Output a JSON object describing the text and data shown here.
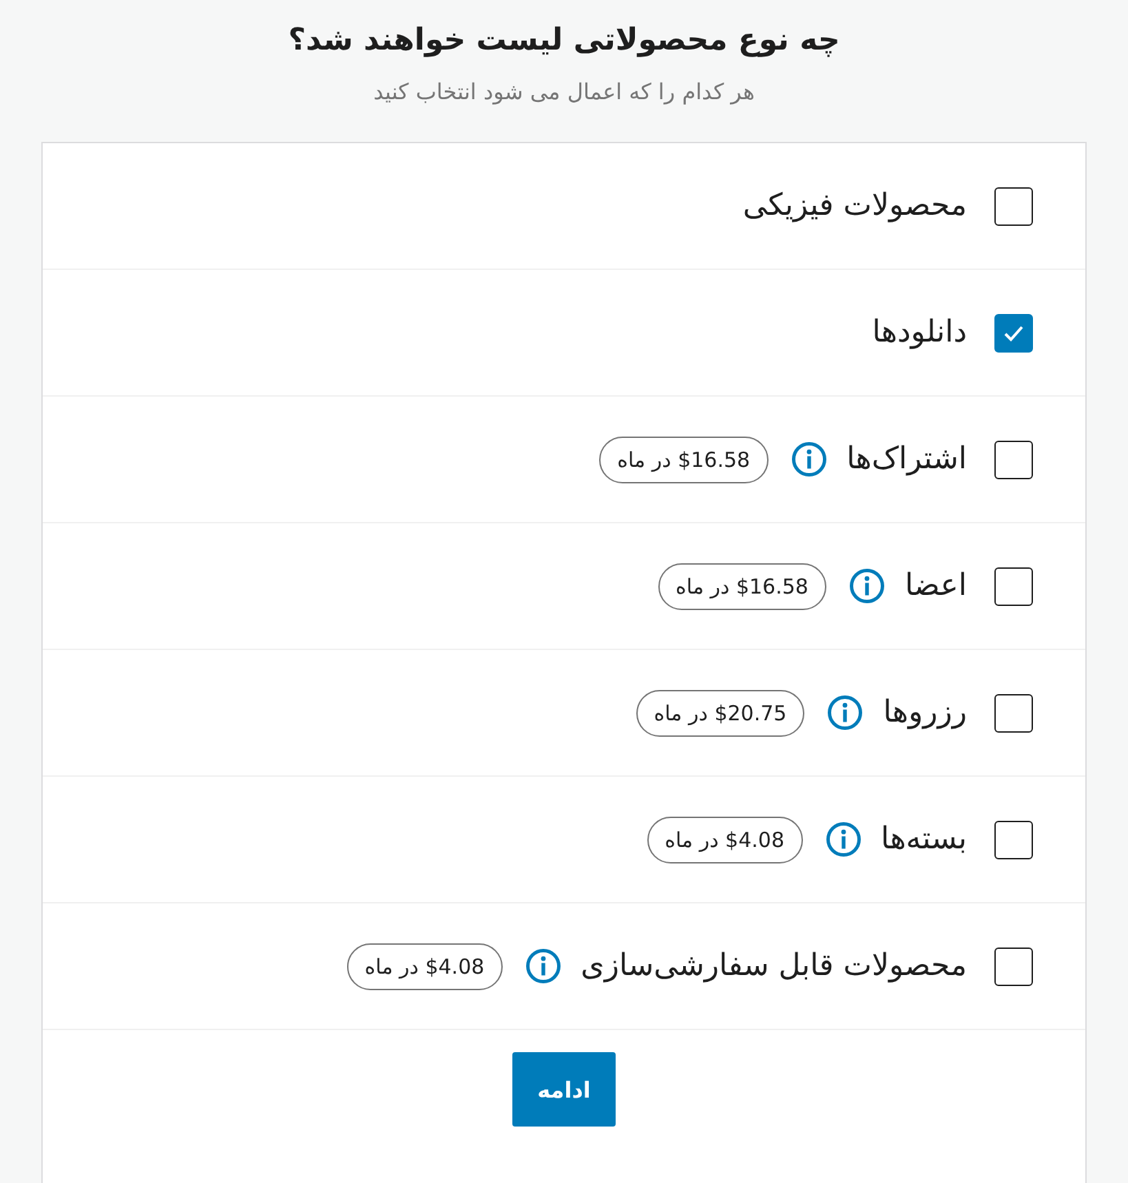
{
  "title": "چه نوع محصولاتی لیست خواهند شد؟",
  "subtitle": "هر کدام را که اعمال می شود انتخاب کنید",
  "options": [
    {
      "label": "محصولات فیزیکی",
      "checked": false
    },
    {
      "label": "دانلودها",
      "checked": true
    },
    {
      "label": "اشتراک‌ها",
      "checked": false,
      "price": "$16.58 در ماه"
    },
    {
      "label": "اعضا",
      "checked": false,
      "price": "$16.58 در ماه"
    },
    {
      "label": "رزروها",
      "checked": false,
      "price": "$20.75 در ماه"
    },
    {
      "label": "بسته‌ها",
      "checked": false,
      "price": "$4.08 در ماه"
    },
    {
      "label": "محصولات قابل سفارشی‌سازی",
      "checked": false,
      "price": "$4.08 در ماه"
    }
  ],
  "button": "ادامه"
}
